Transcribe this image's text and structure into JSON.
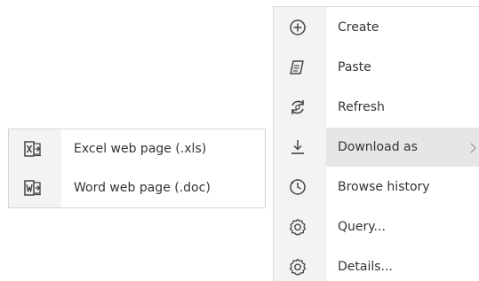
{
  "context_menu": {
    "items": [
      {
        "label": "Create",
        "icon": "plus-circle-icon"
      },
      {
        "label": "Paste",
        "icon": "paste-icon"
      },
      {
        "label": "Refresh",
        "icon": "refresh-icon"
      },
      {
        "label": "Download as",
        "icon": "download-icon",
        "has_submenu": true,
        "active": true
      },
      {
        "label": "Browse history",
        "icon": "clock-history-icon"
      },
      {
        "label": "Query...",
        "icon": "gear-icon"
      },
      {
        "label": "Details...",
        "icon": "gear-icon"
      }
    ]
  },
  "download_submenu": {
    "items": [
      {
        "label": "Excel web page (.xls)",
        "icon": "excel-export-icon"
      },
      {
        "label": "Word web page (.doc)",
        "icon": "word-export-icon"
      }
    ]
  },
  "colors": {
    "text": "#333333",
    "icon": "#444444",
    "icon_column_bg": "#f3f3f3",
    "highlight_bg": "#e6e6e6",
    "border": "#d9d9d9"
  }
}
